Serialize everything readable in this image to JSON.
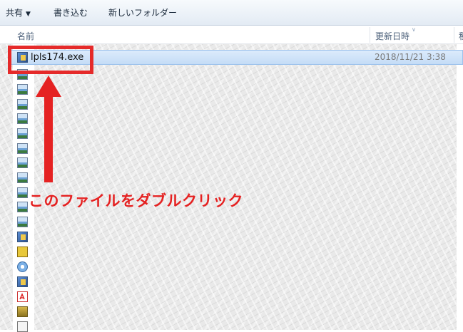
{
  "toolbar": {
    "share_label": "共有",
    "burn_label": "書き込む",
    "new_folder_label": "新しいフォルダー"
  },
  "columns": {
    "name_label": "名前",
    "date_label": "更新日時",
    "type_label_partial": "種"
  },
  "selected_file": {
    "name": "lpls174.exe",
    "modified": "2018/11/21 3:38"
  },
  "annotation": {
    "instruction": "このファイルをダブルクリック",
    "highlight_color": "#e52a2a"
  },
  "file_icons": [
    "exe-icon",
    "image-icon",
    "image-icon",
    "image-icon",
    "image-icon",
    "image-icon",
    "image-icon",
    "image-icon",
    "image-icon",
    "image-icon",
    "image-icon",
    "image-icon",
    "exe-icon",
    "setup-icon",
    "disc-icon",
    "exe-icon",
    "pdf-icon",
    "archive-icon",
    "document-icon"
  ]
}
